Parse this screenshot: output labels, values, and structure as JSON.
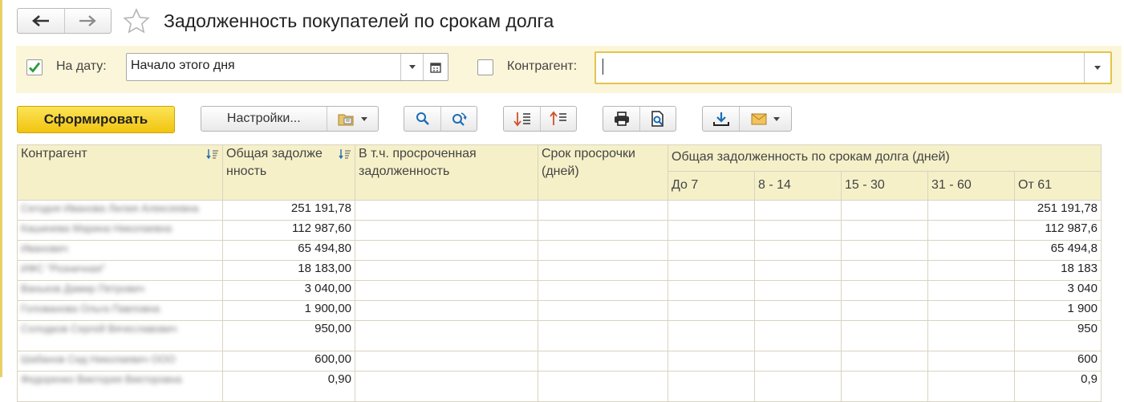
{
  "window": {
    "title": "Задолженность покупателей по срокам долга"
  },
  "filters": {
    "date": {
      "checked": true,
      "label": "На дату:",
      "value": "Начало этого дня"
    },
    "counterparty": {
      "checked": false,
      "label": "Контрагент:",
      "value": ""
    }
  },
  "toolbar": {
    "generate_label": "Сформировать",
    "settings_label": "Настройки..."
  },
  "table": {
    "headers": {
      "counterparty": "Контрагент",
      "total_debt": "Общая задолженность",
      "overdue_debt": "В т.ч. просроченная задолженность",
      "overdue_days": "Срок просрочки (дней)",
      "debt_by_term": "Общая задолженность по срокам долга (дней)"
    },
    "term_columns": [
      "До 7",
      "8 - 14",
      "15 - 30",
      "31 - 60",
      "От 61"
    ],
    "rows": [
      {
        "counterparty": "Сегодня Иванова Лилия Алексеевна",
        "total": "251 191,78",
        "over61": "251 191,78"
      },
      {
        "counterparty": "Кашинева Марина Николаевна",
        "total": "112 987,60",
        "over61": "112 987,6"
      },
      {
        "counterparty": "Иванович",
        "total": "65 494,80",
        "over61": "65 494,8"
      },
      {
        "counterparty": "ИФС \"Розничная\"",
        "total": "18 183,00",
        "over61": "18 183"
      },
      {
        "counterparty": "Ваньков Дамир Петрович",
        "total": "3 040,00",
        "over61": "3 040"
      },
      {
        "counterparty": "Голованова Ольга Павловна",
        "total": "1 900,00",
        "over61": "1 900"
      },
      {
        "counterparty": "Солодков Сергей Вячеславович",
        "total": "950,00",
        "over61": "950"
      },
      {
        "counterparty": "Шабанов Сид Николаевич ООО",
        "total": "600,00",
        "over61": "600"
      },
      {
        "counterparty": "Федоренко Виктория Викторовна",
        "total": "0,90",
        "over61": "0,9"
      }
    ]
  },
  "colors": {
    "accent_yellow": "#f1c40f",
    "header_bg": "#f5f0c8",
    "filter_bg": "#fbf6d9",
    "focus_border": "#e4c44b",
    "check_green": "#2e9b3c"
  },
  "icons": [
    "back-arrow-icon",
    "forward-arrow-icon",
    "star-icon",
    "calendar-icon",
    "folder-variants-icon",
    "search-icon",
    "search-next-icon",
    "sort-descending-icon",
    "sort-ascending-icon",
    "print-icon",
    "print-preview-icon",
    "save-download-icon",
    "envelope-icon",
    "sort-indicator-icon"
  ]
}
